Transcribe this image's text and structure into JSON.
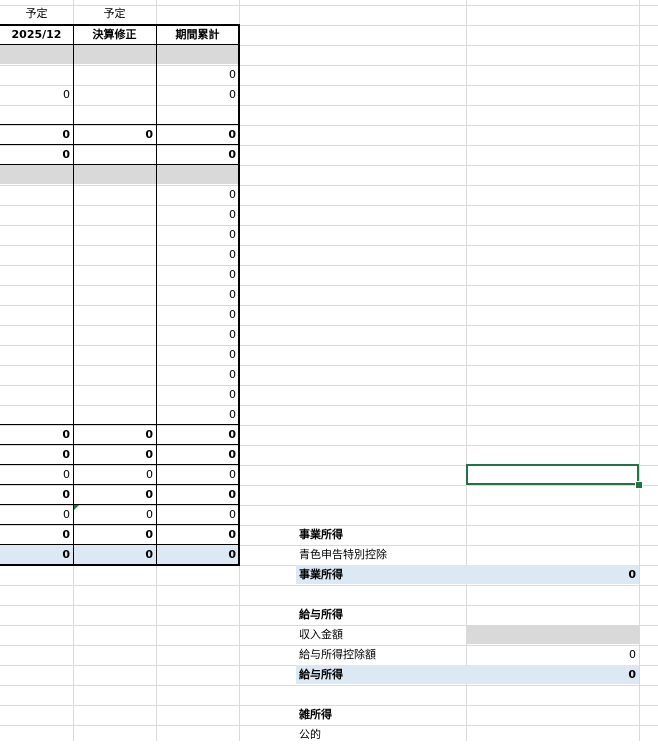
{
  "header": {
    "label_row": [
      "予定",
      "予定"
    ],
    "columns": [
      "2025/12",
      "決算修正",
      "期間累計"
    ]
  },
  "rows": [
    {
      "a": "",
      "b": "",
      "c": "",
      "bold": false
    },
    {
      "a": "",
      "b": "",
      "c": "0",
      "bold": false
    },
    {
      "a": "0",
      "b": "",
      "c": "0",
      "bold": false
    },
    {
      "a": "",
      "b": "",
      "c": "",
      "bold": false
    },
    {
      "a": "0",
      "b": "0",
      "c": "0",
      "bold": true
    },
    {
      "a": "0",
      "b": "",
      "c": "0",
      "bold": true
    },
    {
      "a": "",
      "b": "",
      "c": "",
      "bold": false
    },
    {
      "a": "",
      "b": "",
      "c": "0",
      "bold": false
    },
    {
      "a": "",
      "b": "",
      "c": "0",
      "bold": false
    },
    {
      "a": "",
      "b": "",
      "c": "0",
      "bold": false
    },
    {
      "a": "",
      "b": "",
      "c": "0",
      "bold": false
    },
    {
      "a": "",
      "b": "",
      "c": "0",
      "bold": false
    },
    {
      "a": "",
      "b": "",
      "c": "0",
      "bold": false
    },
    {
      "a": "",
      "b": "",
      "c": "0",
      "bold": false
    },
    {
      "a": "",
      "b": "",
      "c": "0",
      "bold": false
    },
    {
      "a": "",
      "b": "",
      "c": "0",
      "bold": false
    },
    {
      "a": "",
      "b": "",
      "c": "0",
      "bold": false
    },
    {
      "a": "",
      "b": "",
      "c": "0",
      "bold": false
    },
    {
      "a": "",
      "b": "",
      "c": "0",
      "bold": false
    },
    {
      "a": "0",
      "b": "0",
      "c": "0",
      "bold": true
    },
    {
      "a": "0",
      "b": "0",
      "c": "0",
      "bold": true
    },
    {
      "a": "0",
      "b": "0",
      "c": "0",
      "bold": false
    },
    {
      "a": "0",
      "b": "0",
      "c": "0",
      "bold": true
    },
    {
      "a": "0",
      "b": "0",
      "c": "0",
      "bold": false
    },
    {
      "a": "0",
      "b": "0",
      "c": "0",
      "bold": true
    },
    {
      "a": "0",
      "b": "0",
      "c": "0",
      "bold": true
    }
  ],
  "income": {
    "business_heading": "事業所得",
    "blue_deduction_label": "青色申告特別控除",
    "business_total_label": "事業所得",
    "business_total_value": "0",
    "salary_heading": "給与所得",
    "income_amount_label": "収入金額",
    "salary_deduction_label": "給与所得控除額",
    "salary_deduction_value": "0",
    "salary_total_label": "給与所得",
    "salary_total_value": "0",
    "misc_heading": "雑所得",
    "public_label": "公的"
  },
  "colors": {
    "grid": "#dadada",
    "gray_fill": "#d9d9d9",
    "blue_fill": "#dde8f5",
    "selection": "#217346"
  }
}
